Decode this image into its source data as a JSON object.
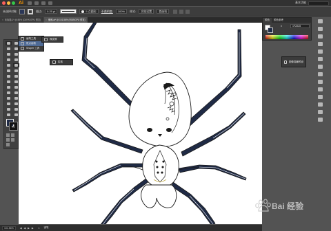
{
  "app": {
    "logo": "Ai",
    "workspace": "基本功能",
    "traffic_colors": [
      "#fc605b",
      "#fdbc40",
      "#34c84a"
    ]
  },
  "control_bar": {
    "selection_label": "未选择对象",
    "stroke_label": "描边:",
    "stroke_weight": "0.25 pt",
    "brush_label": "5 点圆形",
    "opacity_label": "不透明度:",
    "opacity_value": "100%",
    "style_label": "样式:",
    "doc_setup": "文档设置",
    "preferences": "首选项"
  },
  "tabs": [
    {
      "label": "未标题-1* @ 88% (CMYK/GPU 预览)",
      "active": false
    },
    {
      "label": "蜘蛛.ai* @ 101.56% (RGB/GPU 预览)",
      "active": true
    }
  ],
  "flyouts": {
    "main": [
      {
        "label": "画笔工具",
        "icon": "paintbrush-icon"
      },
      {
        "label": "斑点画笔",
        "icon": "blob-brush-icon"
      },
      {
        "label": "Shaper 工具",
        "icon": "shaper-icon"
      }
    ],
    "side": [
      {
        "label": "橡皮擦",
        "icon": "eraser-icon"
      }
    ],
    "lower": [
      {
        "label": "铅笔",
        "icon": "pencil-icon"
      }
    ]
  },
  "color_panel": {
    "tabs": [
      "颜色",
      "颜色参考"
    ],
    "hex_label": "#",
    "hex_value": "1F2A45"
  },
  "floating_panel": {
    "label": "图像描摹预设"
  },
  "status": {
    "zoom": "101.56%",
    "page": "1",
    "tool_name": "钢笔",
    "nav": "◀ ◀ ▶ ▶"
  },
  "watermark": {
    "text": "Bai 经验"
  },
  "colors": {
    "spider_leg": "#1f2a45",
    "spider_outline": "#1a1a1a",
    "canvas": "#ffffff"
  }
}
